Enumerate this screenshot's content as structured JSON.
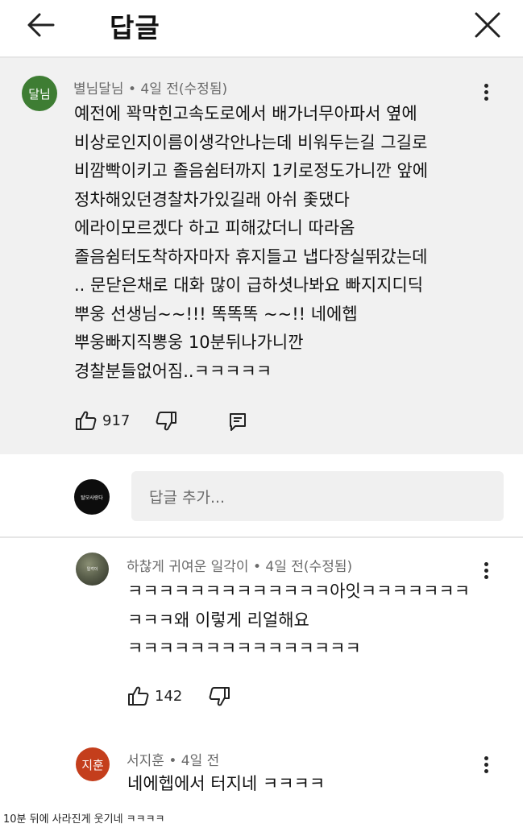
{
  "header": {
    "title": "답글"
  },
  "main_comment": {
    "avatar_text": "달님",
    "avatar_color": "#3e7d33",
    "author": "별님달님",
    "time": "4일 전(수정됨)",
    "lines": [
      "예전에 꽉막힌고속도로에서 배가너무아파서 옆에",
      "비상로인지이름이생각안나는데 비워두는길 그길로",
      "비깜빡이키고 졸음쉼터까지 1키로정도가니깐 앞에",
      "정차해있던경찰차가있길래 아쉬 좇댔다",
      "에라이모르겠다 하고 피해갔더니 따라옴",
      "졸음쉼터도착하자마자 휴지들고 냅다장실뛰갔는데",
      ".. 문닫은채로 대화 많이 급하셧나봐요 빠지지디딕",
      "뿌웅 선생님~~!!! 똑똑똑 ~~!! 네에헵",
      "뿌웅빠지직뽕웅 10분뒤나가니깐",
      "경찰분들없어짐..ㅋㅋㅋㅋㅋ"
    ],
    "likes": "917"
  },
  "reply_box": {
    "avatar_text": "탈모사랑다",
    "placeholder": "답글 추가..."
  },
  "replies": [
    {
      "avatar_text": "일각이",
      "author": "하찮게 귀여운 일각이",
      "time": "4일 전(수정됨)",
      "lines": [
        "ㅋㅋㅋㅋㅋㅋㅋㅋㅋㅋㅋㅋㅋ아잇ㅋㅋㅋㅋㅋㅋㅋ",
        "ㅋㅋㅋ왜 이렇게 리얼해요",
        "ㅋㅋㅋㅋㅋㅋㅋㅋㅋㅋㅋㅋㅋㅋㅋ"
      ],
      "likes": "142"
    },
    {
      "avatar_text": "지훈",
      "avatar_color": "#c43e1c",
      "author": "서지훈",
      "time": "4일 전",
      "lines": [
        "네에헵에서 터지네 ㅋㅋㅋㅋ"
      ]
    }
  ],
  "caption": "10분 뒤에 사라진게 웃기네 ㅋㅋㅋㅋ",
  "icons": {
    "back": "arrow-left-icon",
    "close": "close-x-icon",
    "like": "thumbs-up-icon",
    "dislike": "thumbs-down-icon",
    "reply": "comment-icon",
    "more": "vertical-dots-icon"
  }
}
